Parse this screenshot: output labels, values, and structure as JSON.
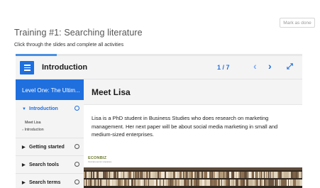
{
  "page": {
    "mark_done_label": "Mark as done",
    "title": "Training #1: Searching literature",
    "subtitle": "Click through the slides and complete all activities"
  },
  "progress": {
    "fraction": 0.143
  },
  "header": {
    "menu_icon": "hamburger-menu-icon",
    "title": "Introduction",
    "page_counter": "1 / 7",
    "prev_icon": "chevron-left-icon",
    "next_icon": "chevron-right-icon",
    "fullscreen_icon": "expand-icon",
    "accent_color": "#1f6fde"
  },
  "sidebar": {
    "header": "Level One: The Ultim...",
    "chapters": [
      {
        "label": "Introduction",
        "expanded": true,
        "sub_items": [
          "Meet Lisa",
          "Introduction"
        ]
      },
      {
        "label": "Getting started"
      },
      {
        "label": "Search tools"
      },
      {
        "label": "Search terms"
      }
    ]
  },
  "slide": {
    "title": "Meet Lisa",
    "text": "Lisa is a PhD student in Business Studies who does research on marketing management. Her next paper will be about social media marketing in small and medium-sized enterprises.",
    "logo": "ECONBIZ",
    "logo_tagline": "Find Economic Literature"
  }
}
